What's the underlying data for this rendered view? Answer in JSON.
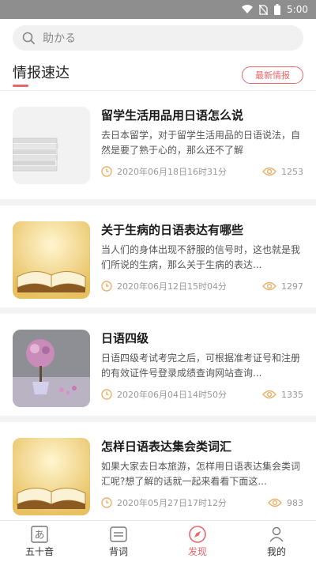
{
  "status_bar": {
    "time": "5:00"
  },
  "search": {
    "placeholder": "助かる"
  },
  "section": {
    "title": "情报速达",
    "latest_button": "最新情报"
  },
  "articles": [
    {
      "title": "留学生活用品用日语怎么说",
      "description": "去日本留学，对于留学生活用品的日语说法，自然是要了熟于心的，那么还不了解",
      "date": "2020年06月18日16时31分",
      "views": "1253",
      "thumb_icon": "stacked-paper"
    },
    {
      "title": "关于生病的日语表达有哪些",
      "description": "当人们的身体出现不舒服的信号时，这也就是我们所说的生病，那么关于生病的表达...",
      "date": "2020年06月12日15时04分",
      "views": "1297",
      "thumb_icon": "open-book"
    },
    {
      "title": "日语四级",
      "description": "日语四级考试考完之后，可根据准考证号和注册的有效证件号登录成绩查询网站查询...",
      "date": "2020年06月04日14时50分",
      "views": "1335",
      "thumb_icon": "flower-pot"
    },
    {
      "title": "怎样日语表达集会类词汇",
      "description": "如果大家去日本旅游，怎样用日语表达集会类词汇呢?想了解的话就一起来看看下面这...",
      "date": "2020年05月27日17时12分",
      "views": "983",
      "thumb_icon": "open-book"
    }
  ],
  "tabs": [
    {
      "label": "五十音",
      "icon": "kana-a-icon",
      "glyph": "あ",
      "active": false
    },
    {
      "label": "背词",
      "icon": "card-icon",
      "active": false
    },
    {
      "label": "发现",
      "icon": "compass-icon",
      "active": true
    },
    {
      "label": "我的",
      "icon": "user-icon",
      "active": false
    }
  ],
  "colors": {
    "accent": "#e8676b",
    "meta_icon": "#e9b26a"
  }
}
